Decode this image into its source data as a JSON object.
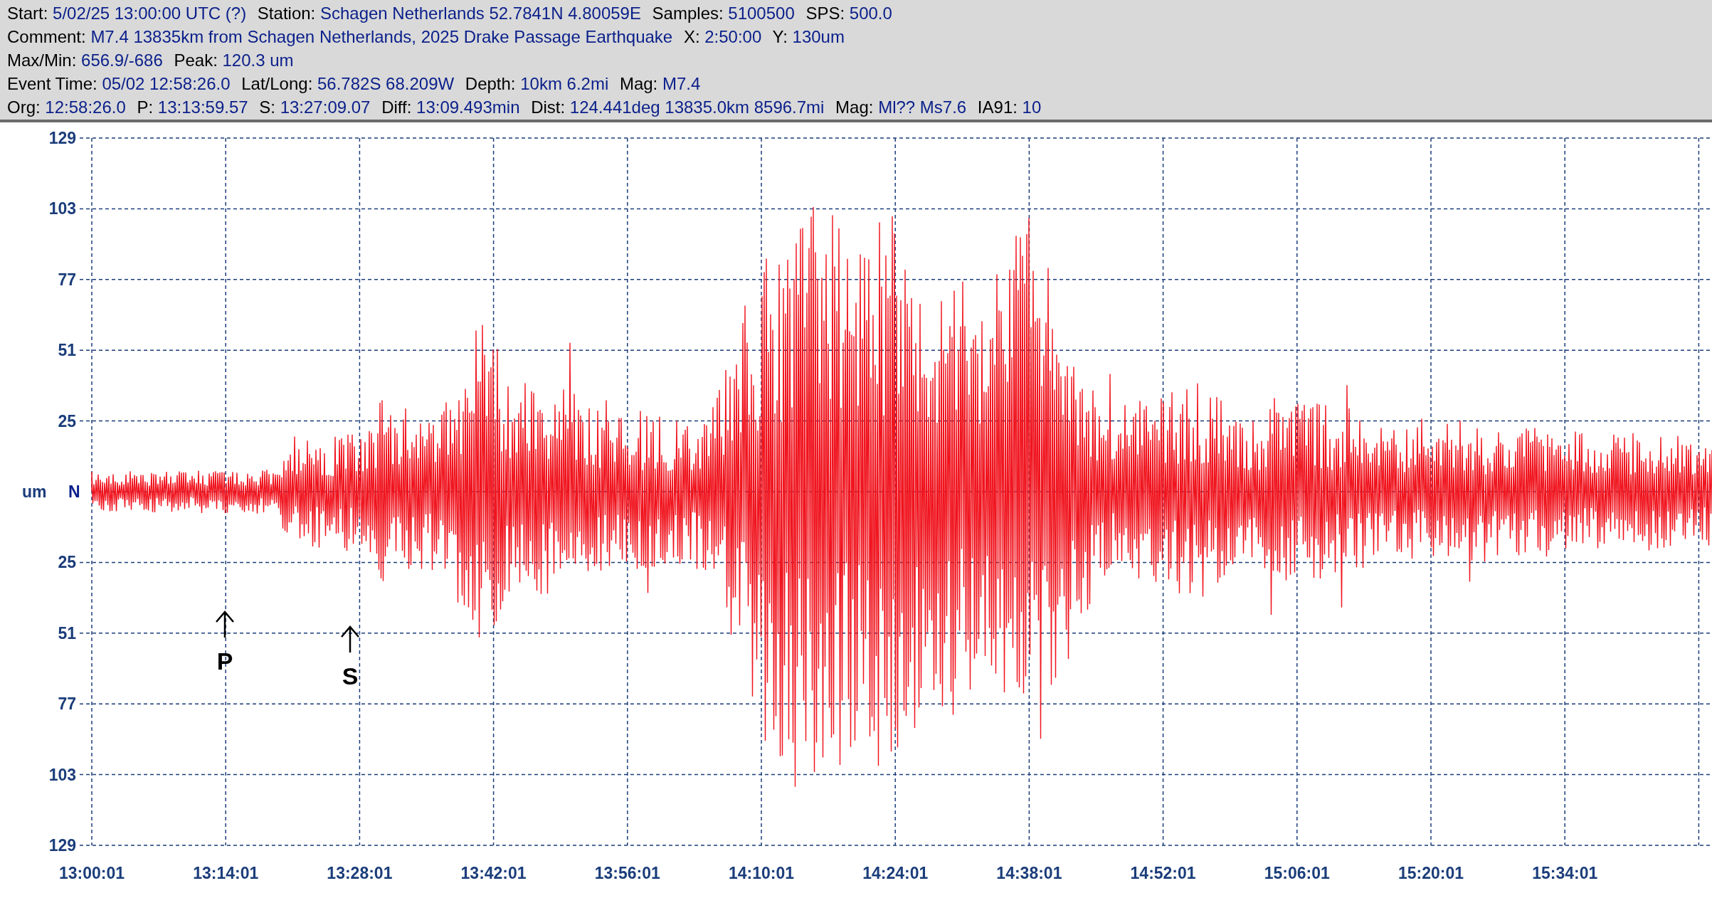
{
  "header": {
    "lines": [
      [
        {
          "label": "Start:",
          "value": "5/02/25 13:00:00 UTC (?)"
        },
        {
          "label": "Station:",
          "value": "Schagen Netherlands 52.7841N 4.80059E"
        },
        {
          "label": "Samples:",
          "value": "5100500"
        },
        {
          "label": "SPS:",
          "value": "500.0"
        }
      ],
      [
        {
          "label": "Comment:",
          "value": "M7.4 13835km from Schagen Netherlands, 2025 Drake Passage Earthquake"
        },
        {
          "label": "X:",
          "value": "2:50:00"
        },
        {
          "label": "Y:",
          "value": "130um"
        }
      ],
      [
        {
          "label": "Max/Min:",
          "value": "656.9/-686"
        },
        {
          "label": "Peak:",
          "value": "120.3 um"
        }
      ],
      [
        {
          "label": "Event Time:",
          "value": "05/02 12:58:26.0"
        },
        {
          "label": "Lat/Long:",
          "value": "56.782S 68.209W"
        },
        {
          "label": "Depth:",
          "value": "10km 6.2mi"
        },
        {
          "label": "Mag:",
          "value": "M7.4"
        }
      ],
      [
        {
          "label": "Org:",
          "value": "12:58:26.0"
        },
        {
          "label": "P:",
          "value": "13:13:59.57"
        },
        {
          "label": "S:",
          "value": "13:27:09.07"
        },
        {
          "label": "Diff:",
          "value": "13:09.493min"
        },
        {
          "label": "Dist:",
          "value": "124.441deg 13835.0km 8596.7mi"
        },
        {
          "label": "Mag:",
          "value": "Ml?? Ms7.6"
        },
        {
          "label": "IA91:",
          "value": "10"
        }
      ]
    ]
  },
  "plot": {
    "y_axis": {
      "ticks": [
        "129",
        "103",
        "77",
        "51",
        "25",
        "25",
        "51",
        "77",
        "103",
        "129"
      ],
      "unit": "um",
      "channel": "N"
    },
    "x_axis": {
      "ticks": [
        "13:00:01",
        "13:14:01",
        "13:28:01",
        "13:42:01",
        "13:56:01",
        "14:10:01",
        "14:24:01",
        "14:38:01",
        "14:52:01",
        "15:06:01",
        "15:20:01",
        "15:34:01"
      ]
    },
    "phase_markers": [
      {
        "label": "P"
      },
      {
        "label": "S"
      }
    ]
  }
}
